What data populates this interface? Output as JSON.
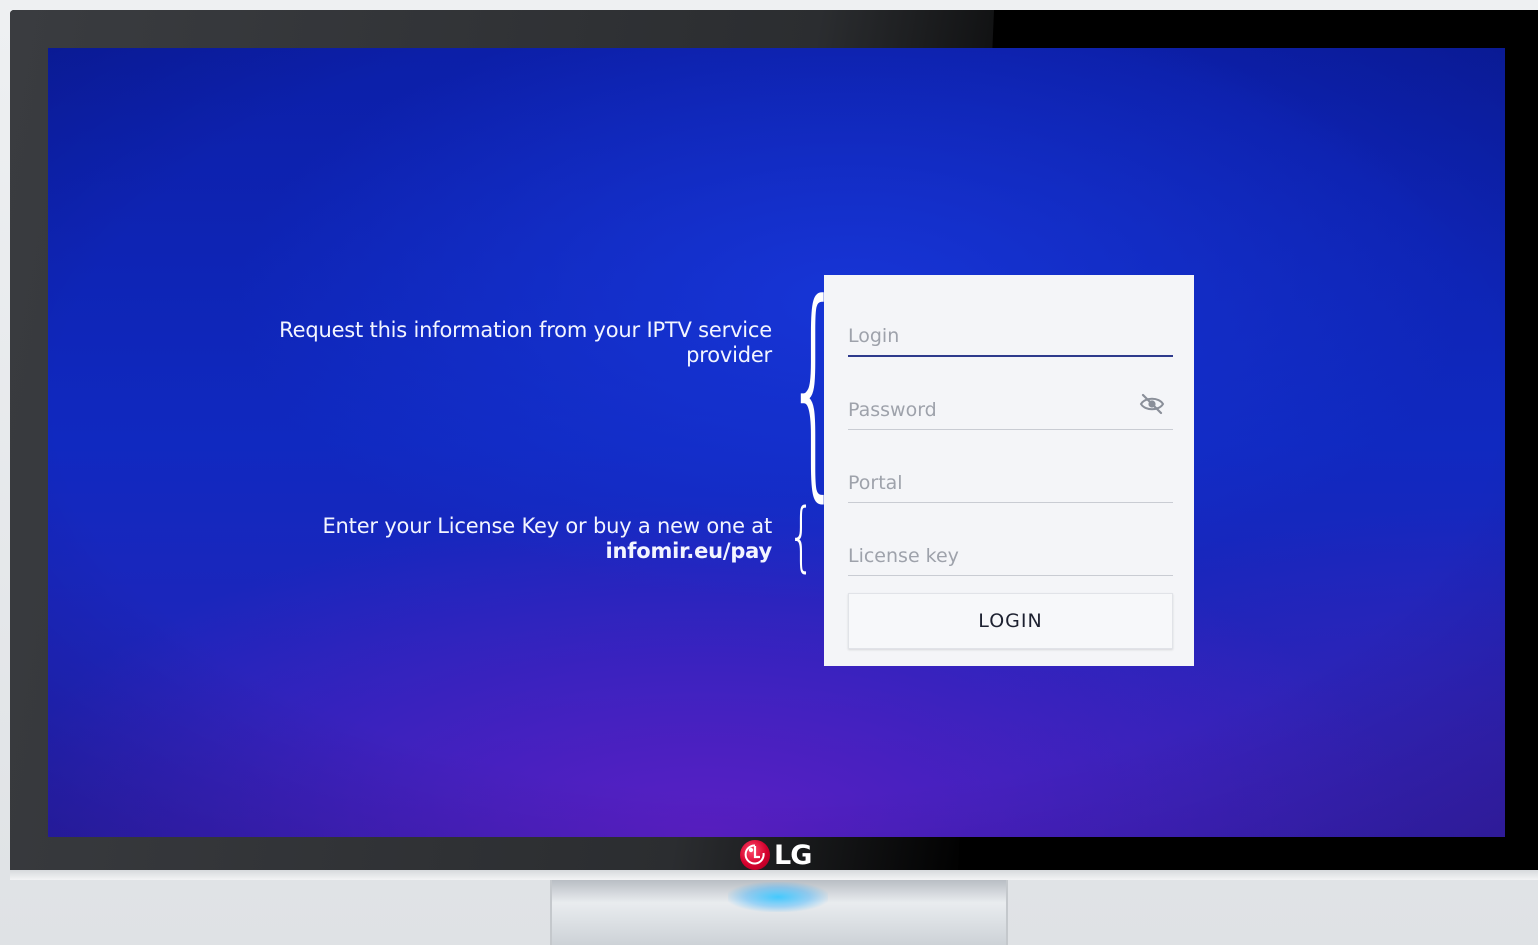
{
  "brand": {
    "name": "LG",
    "logo_color": "#d4002d"
  },
  "hints": {
    "credentials_text": "Request this information from your IPTV service provider",
    "license_text": "Enter your License Key or buy a new one at",
    "license_link": "infomir.eu/pay"
  },
  "form": {
    "login": {
      "placeholder": "Login",
      "value": ""
    },
    "password": {
      "placeholder": "Password",
      "value": "",
      "toggle_icon": "eye-off-icon"
    },
    "portal": {
      "placeholder": "Portal",
      "value": ""
    },
    "license_key": {
      "placeholder": "License key",
      "value": ""
    },
    "login_button": "LOGIN"
  },
  "colors": {
    "screen_background": "#1029c0",
    "panel_background": "#f4f5f8",
    "active_underline": "#2e3a8c"
  }
}
